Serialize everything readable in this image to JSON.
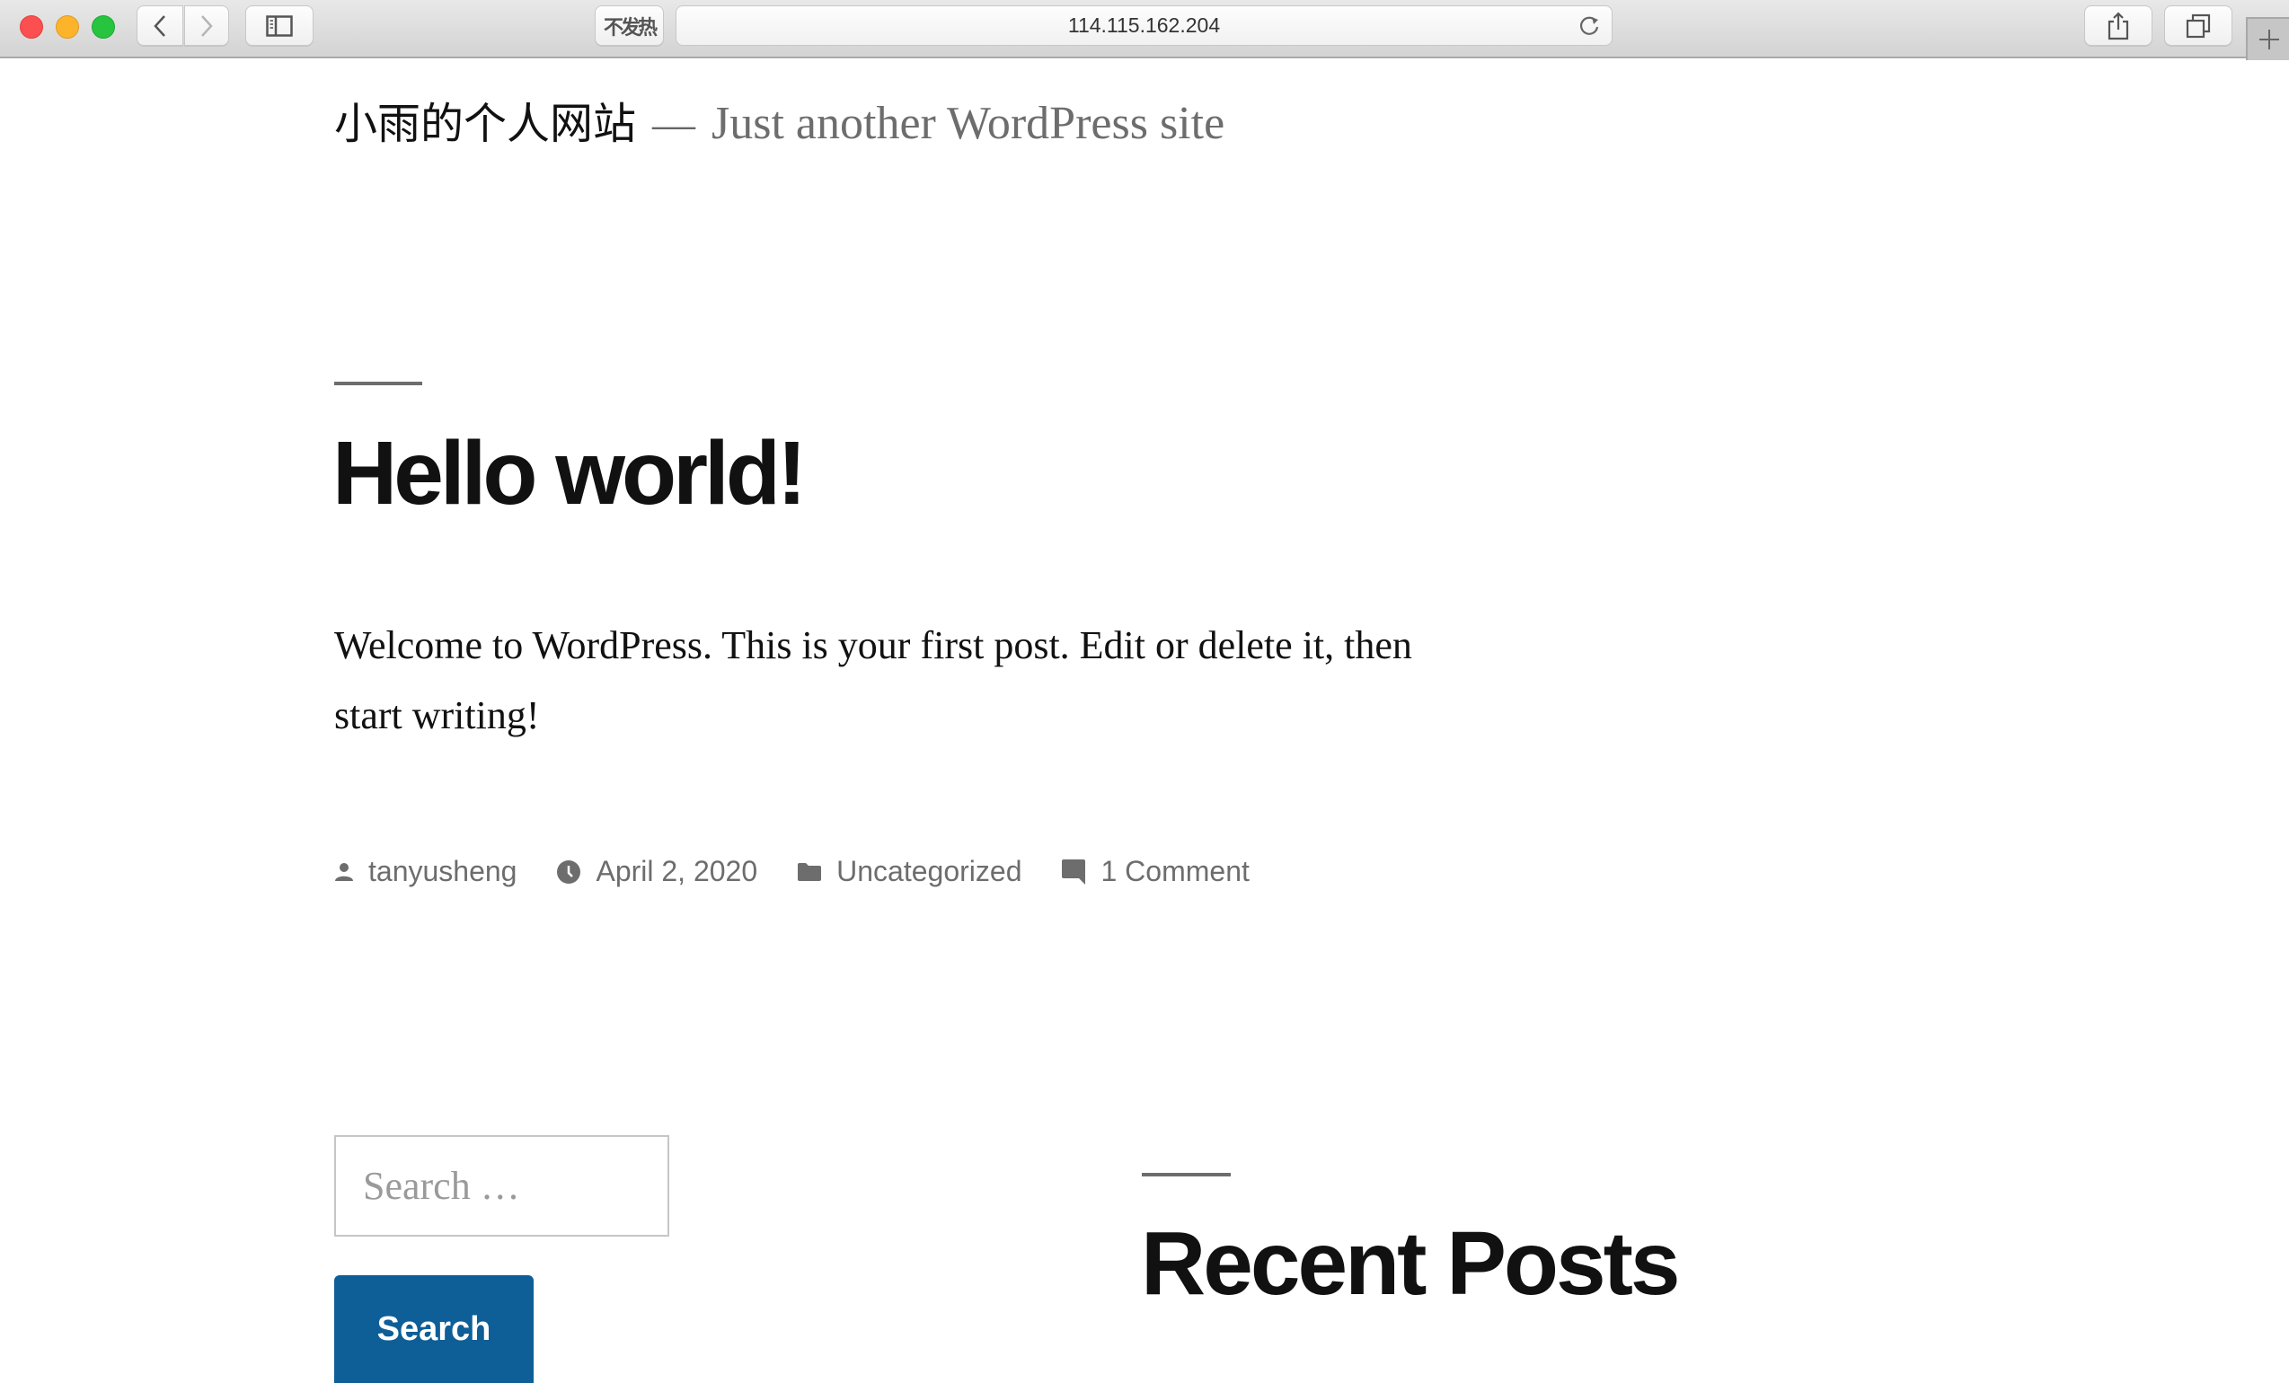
{
  "browser": {
    "window_controls": [
      "close",
      "minimize",
      "zoom"
    ],
    "extension_label": "不发热",
    "address": "114.115.162.204",
    "icons": {
      "back": "chevron-left-icon",
      "forward": "chevron-right-icon",
      "sidebar": "sidebar-icon",
      "reload": "reload-icon",
      "share": "share-icon",
      "tabs": "tabs-overview-icon",
      "new_tab": "plus-icon"
    }
  },
  "site": {
    "title": "小雨的个人网站",
    "separator": "—",
    "description": "Just another WordPress site"
  },
  "post": {
    "title": "Hello world!",
    "body": "Welcome to WordPress. This is your first post. Edit or delete it, then start writing!",
    "meta": {
      "author": "tanyusheng",
      "date": "April 2, 2020",
      "category": "Uncategorized",
      "comments": "1 Comment"
    }
  },
  "sidebar": {
    "search": {
      "placeholder": "Search …",
      "value": "",
      "button_label": "Search"
    },
    "recent_posts_title": "Recent Posts"
  },
  "colors": {
    "accent": "#0e5e97",
    "text": "#111111",
    "meta_text": "#6d6d6d"
  }
}
